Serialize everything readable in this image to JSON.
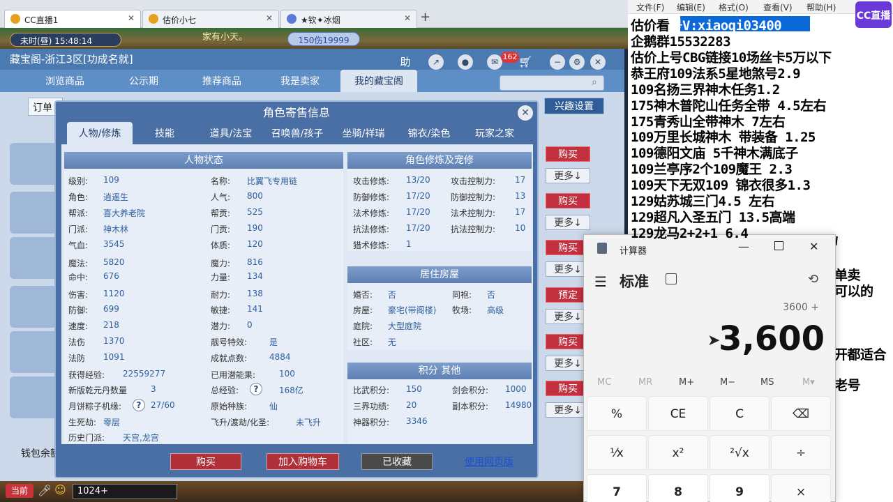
{
  "browser": {
    "tabs": [
      {
        "label": "CC直播1",
        "active": true
      },
      {
        "label": "估价小七",
        "active": false
      },
      {
        "label": "★钦✦冰烟",
        "active": false
      }
    ],
    "new_tab": "+"
  },
  "game": {
    "time": "未时(昼)  15:48:14",
    "hp": "150伤19999",
    "motto": "家有小天。"
  },
  "shop": {
    "title": "藏宝阁-浙江3区[功成名就]",
    "icon_help": "助",
    "badge": "162",
    "nav": [
      "浏览商品",
      "公示期",
      "推荐商品",
      "我是卖家",
      "我的藏宝阁"
    ],
    "order_tab": "订单",
    "interest": "兴趣设置",
    "wallet": "钱包余额",
    "buy": "购买",
    "more": "更多↓",
    "reserve": "预定"
  },
  "dialog": {
    "title": "角色寄售信息",
    "tabs": [
      "人物/修炼",
      "技能",
      "道具/法宝",
      "召唤兽/孩子",
      "坐骑/祥瑞",
      "锦衣/染色",
      "玩家之家"
    ],
    "status_head": "人物状态",
    "cultivation_head": "角色修炼及宠修",
    "house_head": "居住房屋",
    "score_head": "积分 其他",
    "left": [
      [
        "级别:",
        "109"
      ],
      [
        "角色:",
        "逍遥生"
      ],
      [
        "帮派:",
        "喜大养老院"
      ],
      [
        "门派:",
        "神木林"
      ],
      [
        "气血:",
        "3545"
      ],
      [
        "魔法:",
        "5820"
      ],
      [
        "命中:",
        "676"
      ],
      [
        "伤害:",
        "1120"
      ],
      [
        "防御:",
        "699"
      ],
      [
        "速度:",
        "218"
      ],
      [
        "法伤",
        "1370"
      ],
      [
        "法防",
        "1091"
      ],
      [
        "获得经验:",
        "22559277"
      ],
      [
        "新版乾元丹数量",
        "3"
      ],
      [
        "月饼粽子机缘:",
        "27/60"
      ],
      [
        "生死劫:",
        "零层"
      ],
      [
        "历史门派:",
        "天宫,龙宫"
      ]
    ],
    "mid": [
      [
        "名称:",
        "比翼飞专用链"
      ],
      [
        "人气:",
        "800"
      ],
      [
        "帮贡:",
        "525"
      ],
      [
        "门贡:",
        "190"
      ],
      [
        "体质:",
        "120"
      ],
      [
        "魔力:",
        "816"
      ],
      [
        "力量:",
        "134"
      ],
      [
        "耐力:",
        "138"
      ],
      [
        "敏捷:",
        "141"
      ],
      [
        "潜力:",
        "0"
      ],
      [
        "靓号特效:",
        "是"
      ],
      [
        "成就点数:",
        "4884"
      ],
      [
        "已用潜能果:",
        "100"
      ],
      [
        "总经验:",
        "168亿"
      ],
      [
        "原始种族:",
        "仙"
      ],
      [
        "飞升/渡劫/化圣:",
        "未飞升"
      ]
    ],
    "cult": [
      [
        "攻击修炼:",
        "13/20",
        "攻击控制力:",
        "17"
      ],
      [
        "防御修炼:",
        "17/20",
        "防御控制力:",
        "13"
      ],
      [
        "法术修炼:",
        "17/20",
        "法术控制力:",
        "17"
      ],
      [
        "抗法修炼:",
        "17/20",
        "抗法控制力:",
        "10"
      ],
      [
        "猎术修炼:",
        "1",
        "",
        ""
      ]
    ],
    "house": [
      [
        "婚否:",
        "否",
        "同袍:",
        "否"
      ],
      [
        "房屋:",
        "豪宅(带阁楼)",
        "牧场:",
        "高级"
      ],
      [
        "庭院:",
        "大型庭院",
        "",
        ""
      ],
      [
        "社区:",
        "无",
        "",
        ""
      ]
    ],
    "score": [
      [
        "比武积分:",
        "150",
        "剑会积分:",
        "1000"
      ],
      [
        "三界功绩:",
        "20",
        "副本积分:",
        "14980"
      ],
      [
        "神器积分:",
        "3346",
        "",
        ""
      ]
    ],
    "buttons": [
      "购买",
      "加入购物车",
      "已收藏"
    ],
    "web": "使用网页版",
    "help": "?"
  },
  "notepad": {
    "menu": [
      "文件(F)",
      "编辑(E)",
      "格式(O)",
      "查看(V)",
      "帮助(H)"
    ],
    "line0a": "估价看",
    "line0b": "号V:xiaoqi03400",
    "lines": [
      "企鹅群15532283",
      "估价上号CBG链接10场丝卡5万以下",
      "恭王府109法系5星地煞号2.9",
      "109名扬三界神木任务1.2",
      "175神木普陀山任务全带 4.5左右",
      "175青秀山全带神木  7左右",
      "109万里长城神木 带装备  1.25",
      "109德阳文庙 5千神木满底子",
      "109兰亭序2个109魔王 2.3",
      "109天下无双109  锦衣很多1.3",
      "129姑苏城三门4.5 左右",
      "129超凡入圣五门  13.5高端",
      "129龙马2+2+1  6.4"
    ],
    "partial": [
      "W",
      "单卖",
      "可以的",
      "开都适合",
      "老号"
    ],
    "logo": "CC直播"
  },
  "calc": {
    "title": "计算器",
    "mode": "标准",
    "expr": "3600 +",
    "display": "3,600",
    "memory": [
      "MC",
      "MR",
      "M+",
      "M−",
      "MS",
      "M▾"
    ],
    "keys": [
      "%",
      "CE",
      "C",
      "⌫",
      "¹⁄x",
      "x²",
      "²√x",
      "÷",
      "7",
      "8",
      "9",
      "×"
    ]
  }
}
